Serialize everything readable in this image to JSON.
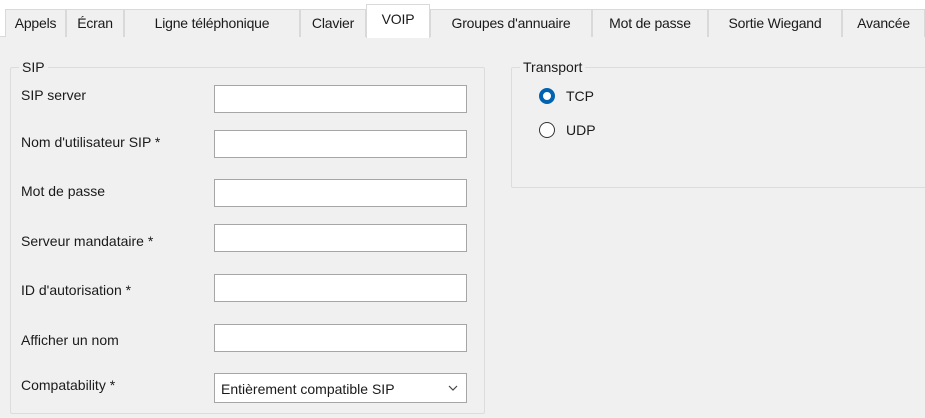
{
  "tabs": [
    {
      "label": "Appels"
    },
    {
      "label": "Écran"
    },
    {
      "label": "Ligne téléphonique"
    },
    {
      "label": "Clavier"
    },
    {
      "label": "VOIP"
    },
    {
      "label": "Groupes d'annuaire"
    },
    {
      "label": "Mot de passe"
    },
    {
      "label": "Sortie Wiegand"
    },
    {
      "label": "Avancée"
    }
  ],
  "active_tab": "VOIP",
  "sip": {
    "title": "SIP",
    "fields": [
      {
        "label": "SIP server",
        "value": ""
      },
      {
        "label": "Nom d'utilisateur SIP *",
        "value": ""
      },
      {
        "label": "Mot de passe",
        "value": ""
      },
      {
        "label": "Serveur mandataire *",
        "value": ""
      },
      {
        "label": "ID d'autorisation *",
        "value": ""
      },
      {
        "label": "Afficher un nom",
        "value": ""
      }
    ],
    "compat": {
      "label": "Compatability *",
      "selected": "Entièrement compatible SIP"
    }
  },
  "transport": {
    "title": "Transport",
    "options": [
      {
        "label": "TCP",
        "checked": true
      },
      {
        "label": "UDP",
        "checked": false
      }
    ]
  },
  "colors": {
    "accent": "#0063b1",
    "panel_bg": "#f0f0f0",
    "tab_border": "#d9d9d9"
  }
}
